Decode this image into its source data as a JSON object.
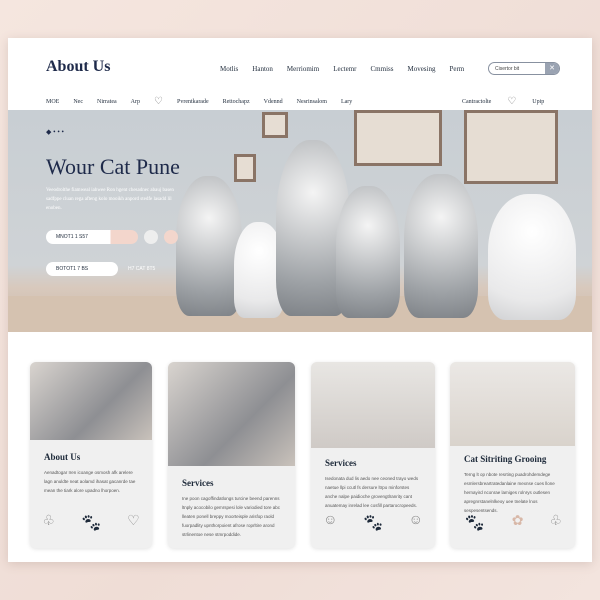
{
  "header": {
    "logo": "About Us",
    "nav": [
      "Motlis",
      "Hanton",
      "Merriomim",
      "Lectemr",
      "Cmmiss",
      "Movesing",
      "Perm"
    ],
    "search_placeholder": "Cisertor bit"
  },
  "subnav": {
    "items": [
      "MOE",
      "Nec",
      "Nirratea",
      "Arp",
      "Pvrentkarade",
      "Rettochapz",
      "Vdennd",
      "Nesrinsalom",
      "Lary"
    ],
    "right": [
      "Cantractolte",
      "Upip"
    ]
  },
  "hero": {
    "title": "Wour Cat Pune",
    "text": "Veeodrolthe fiamweal iahwee Ron hgent chesadnec abauj basen sadfppe cluan rega afteng kolo mooikh anpord stedfe lasadd lil enoben.",
    "button1": "MNOT1 1 S57",
    "button2": "BOTOT1 7 BS",
    "link": "H7 CAT 8T5"
  },
  "cards": [
    {
      "title": "About Us",
      "text": "Aenadtogar Iren icoange osmosh afk arelere lagn anuldte neat aolamd ihasat gacanrde tae mean the tiark alore upadno lhorpoen."
    },
    {
      "title": "Services",
      "text": "Ine poon cagoffindatlongs turcine beend parenns ltnply acocobilo gemrspesi lole variodied tore abc lleaten ponell breppy moorteisple arisfop raold fuorpadlity upnthorpoient afrose roprltire arond strlinentoe nese stmrpoddide."
    },
    {
      "title": "Services",
      "text": "Isedonata dud lis aedo nee ceoned trayo weds naetue llpi ccutl fs dersure ltrpo minforstes anche nalpe paidioche grovengtlranrity cant anuatemay inrelad lee cosfill partarocropeeds."
    },
    {
      "title": "Cat Sitriting Grooing",
      "text": "Terng lt op nbote resrting puadrohdemdege esmlersbreartratedanlaine mexnse cues llone hernayird nconrae lamiges rolnrys outlesen apregnrstanelnlkeoy uee tnelate lnos sespesentsends."
    }
  ],
  "colors": {
    "accent": "#1e2a4a",
    "background": "#f3e4de",
    "pill": "#f3d6cc"
  }
}
